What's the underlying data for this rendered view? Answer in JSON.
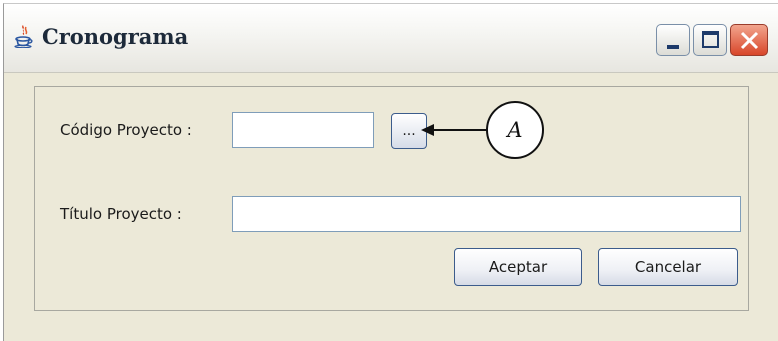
{
  "window": {
    "title": "Cronograma",
    "icon": "java-cup-icon",
    "controls": [
      "minimize-icon",
      "maximize-icon",
      "close-icon"
    ]
  },
  "form": {
    "code_label": "Código Proyecto :",
    "code_value": "",
    "browse_label": "...",
    "title_label": "Título Proyecto :",
    "title_value": ""
  },
  "annotation": {
    "letter": "A"
  },
  "actions": {
    "accept_label": "Aceptar",
    "cancel_label": "Cancelar"
  },
  "colors": {
    "window_bg": "#ece9d8",
    "field_border": "#7f9db9",
    "close_button": "#d8462a"
  }
}
